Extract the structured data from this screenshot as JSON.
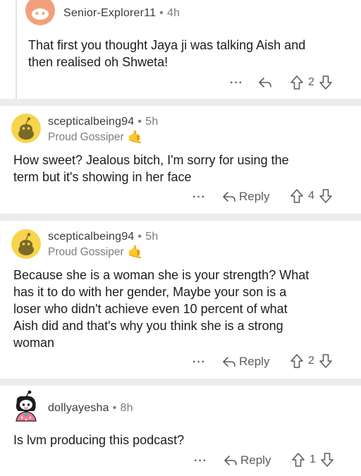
{
  "comments": [
    {
      "username": "Senior-Explorer11",
      "time": "4h",
      "flair": "",
      "body_lines": [
        "That first you thought Jaya ji was talking Aish and",
        "then realised oh Shweta!"
      ],
      "reply_label": "",
      "more_label": "···",
      "score": "2",
      "avatar_color": "#f2a07b"
    },
    {
      "username": "scepticalbeing94",
      "time": "5h",
      "flair": "Proud Gossiper",
      "flair_emoji": "🤙",
      "body_lines": [
        "How sweet? Jealous bitch, I'm sorry for using the",
        "term but it's showing in her face"
      ],
      "reply_label": "Reply",
      "more_label": "···",
      "score": "4",
      "avatar_color": "#f7d44c"
    },
    {
      "username": "scepticalbeing94",
      "time": "5h",
      "flair": "Proud Gossiper",
      "flair_emoji": "🤙",
      "body_lines": [
        "Because she is a woman she is your strength? What",
        "has it to do with her gender, Maybe your son is a",
        "loser who didn't achieve even 10 percent of what",
        "Aish did and that's why you think she is a strong",
        "woman"
      ],
      "reply_label": "Reply",
      "more_label": "···",
      "score": "2",
      "avatar_color": "#f7d44c"
    },
    {
      "username": "dollyayesha",
      "time": "8h",
      "flair": "",
      "body_lines": [
        "Is lvm producing this podcast?"
      ],
      "reply_label": "Reply",
      "more_label": "···",
      "score": "1",
      "avatar_color": "#ffffff"
    }
  ],
  "separator": "•",
  "colors": {
    "divider": "#ececec",
    "meta_text": "#7c7c7c",
    "body_text": "#1c1c1c",
    "action_text": "#5c5c5c"
  },
  "icons": {
    "reply": "reply-arrow-icon",
    "upvote": "upvote-arrow-icon",
    "downvote": "downvote-arrow-icon",
    "more": "more-options-icon"
  }
}
